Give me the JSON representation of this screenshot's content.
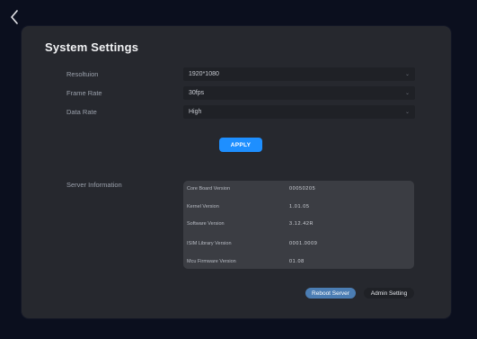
{
  "nav": {
    "back_icon": "chevron-left-icon"
  },
  "page": {
    "title": "System Settings"
  },
  "settings": {
    "resolution": {
      "label": "Resoltuion",
      "value": "1920*1080"
    },
    "frame_rate": {
      "label": "Frame Rate",
      "value": "30fps"
    },
    "data_rate": {
      "label": "Data Rate",
      "value": "High"
    },
    "apply_label": "APPLY"
  },
  "server": {
    "label": "Server Information",
    "rows": [
      {
        "key": "Core Board Version",
        "value": "00050205"
      },
      {
        "key": "Kernel Version",
        "value": "1.01.05"
      },
      {
        "key": "Software Version",
        "value": "3.12.42R"
      },
      {
        "key": "ISIM Library Version",
        "value": "0001.0009"
      },
      {
        "key": "Mcu Firmware Version",
        "value": "01.08"
      }
    ]
  },
  "actions": {
    "reboot_label": "Reboot Server",
    "admin_label": "Admin Setting"
  },
  "colors": {
    "accent": "#1e8fff",
    "reboot": "#4b7db3",
    "panel": "#26282e",
    "background": "#0b0f1e"
  }
}
